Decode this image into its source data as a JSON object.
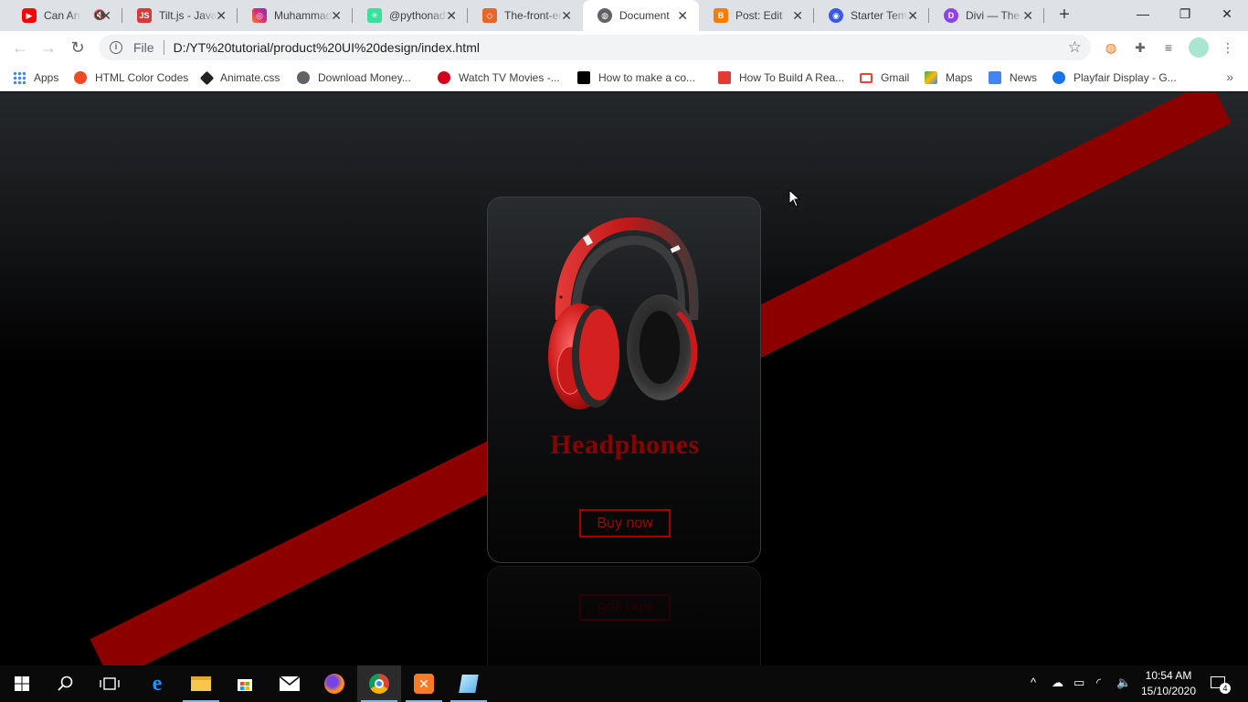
{
  "browser": {
    "tabs": [
      {
        "title": "Can Angular",
        "icon": "youtube-icon",
        "color": "#ff0000",
        "muted": true
      },
      {
        "title": "Tilt.js - JavaScript",
        "icon": "tiltjs-icon",
        "color": "#d93838"
      },
      {
        "title": "Muhammad",
        "icon": "instagram-icon",
        "color": "#c13584"
      },
      {
        "title": "@pythonadv",
        "icon": "linktree-icon",
        "color": "#39e09b"
      },
      {
        "title": "The-front-end",
        "icon": "codepen-icon",
        "color": "#e8652b"
      },
      {
        "title": "Document",
        "icon": "globe-icon",
        "color": "#5f6368",
        "active": true
      },
      {
        "title": "Post: Edit",
        "icon": "blogger-icon",
        "color": "#f57d00"
      },
      {
        "title": "Starter Templates",
        "icon": "starter-templates-icon",
        "color": "#3858e9"
      },
      {
        "title": "Divi — The",
        "icon": "divi-icon",
        "color": "#8f42ec"
      }
    ],
    "address": {
      "scheme_label": "File",
      "url": "D:/YT%20tutorial/product%20UI%20design/index.html"
    },
    "bookmarks": [
      {
        "label": "Apps",
        "icon": "apps-grid-icon",
        "color": "#4285f4"
      },
      {
        "label": "HTML Color Codes",
        "icon": "html-color-codes-icon",
        "color": "#f04a24"
      },
      {
        "label": "Animate.css",
        "icon": "animate-css-icon",
        "color": "#222222"
      },
      {
        "label": "Download Money...",
        "icon": "globe-icon",
        "color": "#5f6368"
      },
      {
        "label": "Watch TV Movies -...",
        "icon": "tv-movies-icon",
        "color": "#d0021b"
      },
      {
        "label": "How to make a co...",
        "icon": "tutorial-icon",
        "color": "#000000"
      },
      {
        "label": "How To Build A Rea...",
        "icon": "article-icon",
        "color": "#e53935"
      },
      {
        "label": "Gmail",
        "icon": "gmail-icon",
        "color": "#ea4335"
      },
      {
        "label": "Maps",
        "icon": "maps-icon",
        "color": "#34a853"
      },
      {
        "label": "News",
        "icon": "news-icon",
        "color": "#4285f4"
      },
      {
        "label": "Playfair Display - G...",
        "icon": "google-fonts-icon",
        "color": "#1a73e8"
      }
    ]
  },
  "page": {
    "product_name": "Headphones",
    "buy_label": "Buy now",
    "reflection_label": "Buy now",
    "accent_color": "#8b0000"
  },
  "taskbar": {
    "apps": [
      {
        "icon": "start-icon"
      },
      {
        "icon": "search-icon"
      },
      {
        "icon": "task-view-icon"
      },
      {
        "icon": "edge-icon"
      },
      {
        "icon": "file-explorer-icon"
      },
      {
        "icon": "store-icon"
      },
      {
        "icon": "mail-icon"
      },
      {
        "icon": "firefox-icon"
      },
      {
        "icon": "chrome-icon",
        "active": true
      },
      {
        "icon": "xampp-icon"
      },
      {
        "icon": "notepad-icon"
      }
    ],
    "time": "10:54 AM",
    "date": "15/10/2020",
    "notification_count": "4"
  }
}
